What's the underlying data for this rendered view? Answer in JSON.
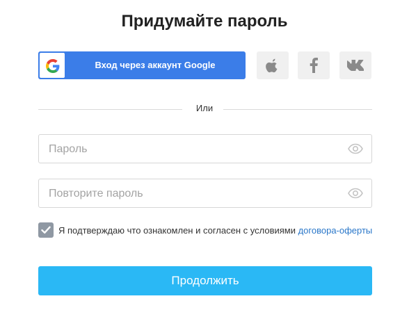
{
  "title": "Придумайте пароль",
  "social": {
    "google_label": "Вход через аккаунт Google",
    "icons": [
      "google-icon",
      "apple-icon",
      "facebook-icon",
      "vk-icon"
    ]
  },
  "divider": "Или",
  "form": {
    "password_placeholder": "Пароль",
    "repeat_placeholder": "Повторите пароль",
    "password_value": "",
    "repeat_value": ""
  },
  "agreement": {
    "checked": true,
    "text": "Я подтверждаю что ознакомлен и согласен с условиями ",
    "link_text": "договора-оферты"
  },
  "continue_label": "Продолжить",
  "colors": {
    "google_button": "#3b7de8",
    "continue_button": "#2ab8f5",
    "link": "#2a77c9",
    "checkbox": "#8f98a3"
  }
}
